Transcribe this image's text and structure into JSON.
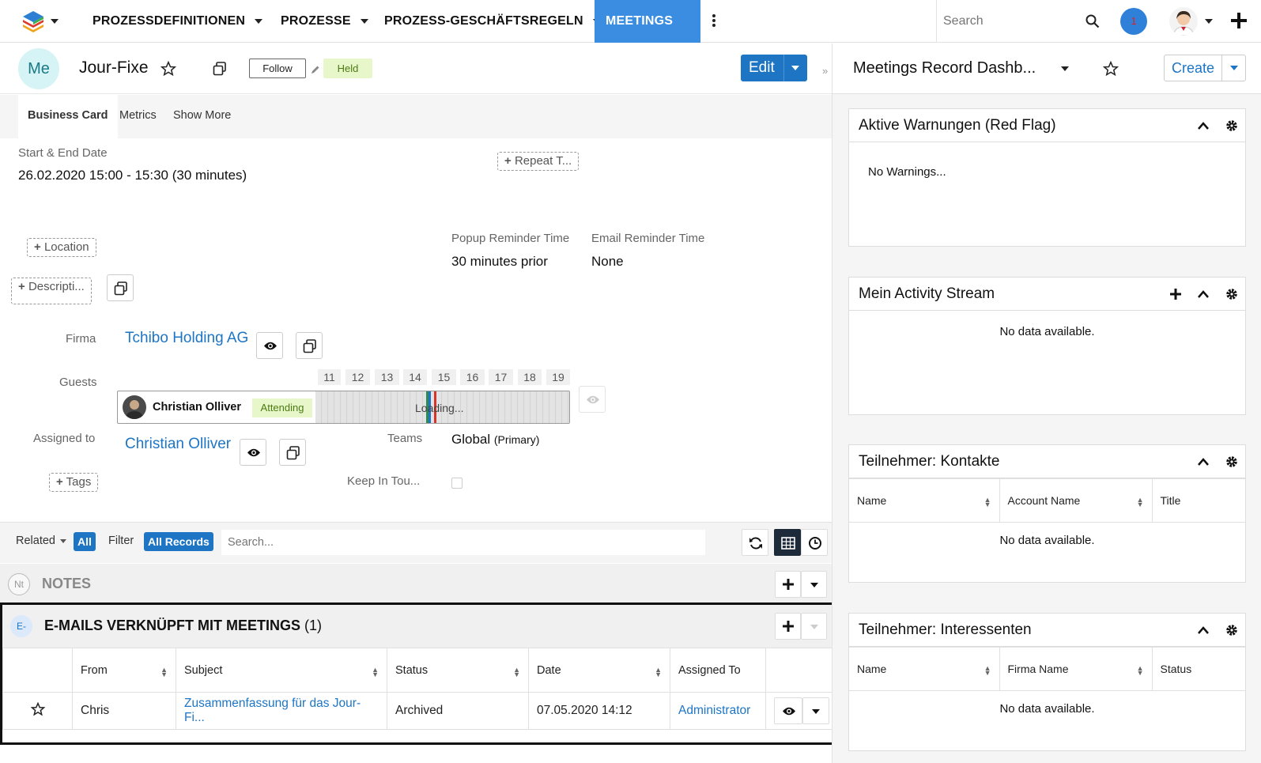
{
  "topnav": {
    "items": [
      {
        "label": "PROZESSDEFINITIONEN"
      },
      {
        "label": "PROZESSE"
      },
      {
        "label": "PROZESS-GESCHÄFTSREGELN"
      },
      {
        "label": "MEETINGS"
      }
    ],
    "search_placeholder": "Search",
    "notification_count": "1"
  },
  "record": {
    "avatar_initials": "Me",
    "title": "Jour-Fixe",
    "follow_label": "Follow",
    "status": "Held",
    "edit_label": "Edit",
    "tabs": [
      "Business Card",
      "Metrics",
      "Show More"
    ],
    "start_end_label": "Start & End Date",
    "start_end_value": "26.02.2020 15:00 - 15:30 (30 minutes)",
    "repeat_label": "Repeat T...",
    "location_label": "Location",
    "description_label": "Descripti...",
    "popup_reminder_label": "Popup Reminder Time",
    "popup_reminder_value": "30 minutes prior",
    "email_reminder_label": "Email Reminder Time",
    "email_reminder_value": "None",
    "firma_label": "Firma",
    "firma_value": "Tchibo Holding AG",
    "guests_label": "Guests",
    "hours": [
      "11",
      "12",
      "13",
      "14",
      "15",
      "16",
      "17",
      "18",
      "19"
    ],
    "guest_name": "Christian Olliver",
    "guest_status": "Attending",
    "loading_text": "Loading...",
    "assigned_label": "Assigned to",
    "assigned_value": "Christian Olliver",
    "teams_label": "Teams",
    "teams_value": "Global",
    "teams_primary": "(Primary)",
    "tags_label": "Tags",
    "keep_in_touch_label": "Keep In Tou..."
  },
  "related": {
    "related_label": "Related",
    "related_value": "All",
    "filter_label": "Filter",
    "filter_value": "All Records",
    "search_placeholder": "Search..."
  },
  "notes": {
    "icon": "Nt",
    "title": "NOTES"
  },
  "emails": {
    "icon": "E-",
    "title": "E-MAILS VERKNÜPFT MIT MEETINGS",
    "count": "(1)",
    "columns": [
      "From",
      "Subject",
      "Status",
      "Date",
      "Assigned To"
    ],
    "rows": [
      {
        "from": "Chris",
        "subject": "Zusammenfassung für das Jour-Fi...",
        "status": "Archived",
        "date": "07.05.2020 14:12",
        "assigned": "Administrator"
      }
    ]
  },
  "dashboard": {
    "title": "Meetings Record Dashb...",
    "create_label": "Create",
    "dashlets": [
      {
        "title": "Aktive Warnungen (Red Flag)",
        "body": "No Warnings..."
      },
      {
        "title": "Mein Activity Stream",
        "body": "No data available."
      },
      {
        "title": "Teilnehmer: Kontakte",
        "columns": [
          "Name",
          "Account Name",
          "Title"
        ],
        "body": "No data available."
      },
      {
        "title": "Teilnehmer: Interessenten",
        "columns": [
          "Name",
          "Firma Name",
          "Status"
        ],
        "body": "No data available."
      }
    ]
  },
  "colors": {
    "primary": "#1d75c4",
    "nav_active": "#3a8de0",
    "held_bg": "#e7f7c9",
    "held_text": "#4d7a12"
  }
}
